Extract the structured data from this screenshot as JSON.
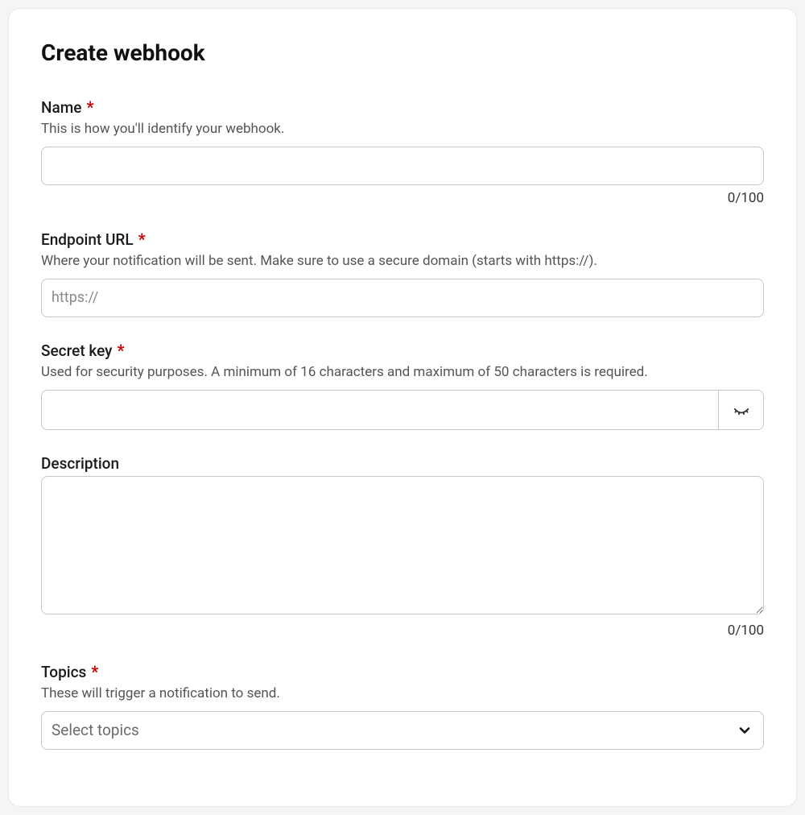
{
  "title": "Create webhook",
  "fields": {
    "name": {
      "label": "Name",
      "required": true,
      "help": "This is how you'll identify your webhook.",
      "value": "",
      "counter": "0/100"
    },
    "endpoint": {
      "label": "Endpoint URL",
      "required": true,
      "help": "Where your notification will be sent. Make sure to use a secure domain (starts with https://).",
      "placeholder": "https://",
      "value": ""
    },
    "secret": {
      "label": "Secret key",
      "required": true,
      "help": "Used for security purposes. A minimum of 16 characters and maximum of 50 characters is required.",
      "value": ""
    },
    "description": {
      "label": "Description",
      "required": false,
      "value": "",
      "counter": "0/100"
    },
    "topics": {
      "label": "Topics",
      "required": true,
      "help": "These will trigger a notification to send.",
      "placeholder": "Select topics"
    }
  },
  "asterisk": "*"
}
